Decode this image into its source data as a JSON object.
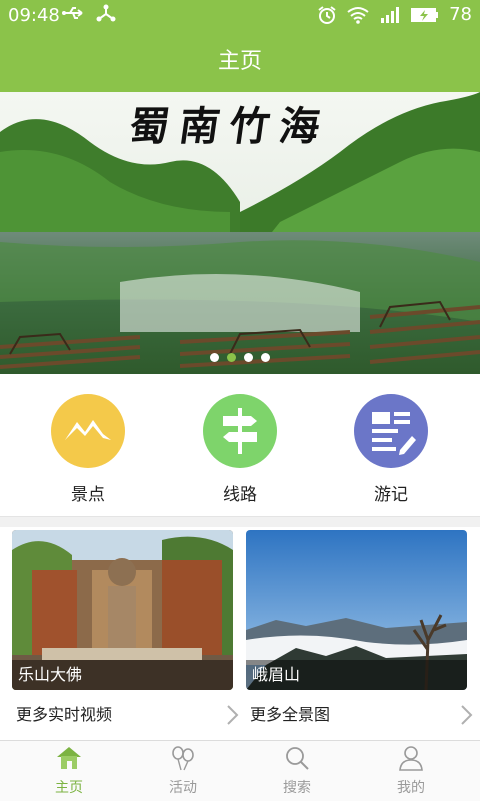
{
  "status_bar": {
    "time": "09:48",
    "battery": "78"
  },
  "header": {
    "title": "主页"
  },
  "banner": {
    "title": "蜀南竹海",
    "dots": [
      false,
      true,
      false,
      false
    ]
  },
  "categories": [
    {
      "label": "景点",
      "icon": "mountain-icon",
      "color": "#f4c94a"
    },
    {
      "label": "线路",
      "icon": "signpost-icon",
      "color": "#7ed46b"
    },
    {
      "label": "游记",
      "icon": "notes-icon",
      "color": "#6b76c8"
    }
  ],
  "cards": [
    {
      "caption": "乐山大佛"
    },
    {
      "caption": "峨眉山"
    }
  ],
  "more_links": [
    {
      "label": "更多实时视频"
    },
    {
      "label": "更多全景图"
    }
  ],
  "tabs": [
    {
      "label": "主页",
      "icon": "home-icon",
      "active": true
    },
    {
      "label": "活动",
      "icon": "balloons-icon",
      "active": false
    },
    {
      "label": "搜索",
      "icon": "search-icon",
      "active": false
    },
    {
      "label": "我的",
      "icon": "user-icon",
      "active": false
    }
  ],
  "colors": {
    "brand": "#8bc34a",
    "active_tab": "#7cb342",
    "inactive_tab": "#9a9a9a"
  }
}
